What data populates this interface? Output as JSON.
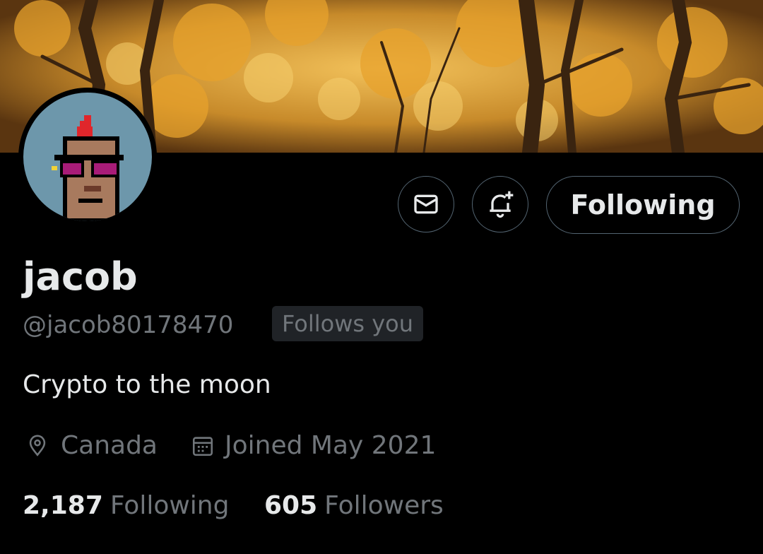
{
  "profile": {
    "display_name": "jacob",
    "handle": "@jacob80178470",
    "follows_you_badge": "Follows you",
    "bio": "Crypto to the moon",
    "location": "Canada",
    "joined": "Joined May 2021"
  },
  "actions": {
    "message_icon": "envelope-icon",
    "notify_icon": "bell-plus-icon",
    "follow_state_label": "Following"
  },
  "stats": {
    "following_count": "2,187",
    "following_label": "Following",
    "followers_count": "605",
    "followers_label": "Followers"
  },
  "colors": {
    "background": "#000000",
    "primary_text": "#e7e9ea",
    "secondary_text": "#71767b",
    "button_border": "#536471",
    "badge_bg": "#202327"
  }
}
